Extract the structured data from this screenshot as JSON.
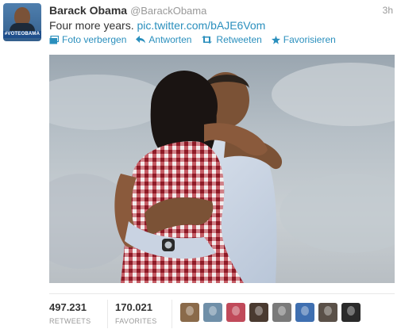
{
  "user": {
    "full_name": "Barack Obama",
    "username": "@BarackObama",
    "avatar_tag": "#VOTEOBAMA",
    "avatar_icon": "profile-photo"
  },
  "tweet": {
    "time": "3h",
    "text": "Four more years.",
    "link": "pic.twitter.com/bAJE6Vom"
  },
  "actions": [
    {
      "label": "Foto verbergen",
      "icon": "photo-icon"
    },
    {
      "label": "Antworten",
      "icon": "reply-icon"
    },
    {
      "label": "Retweeten",
      "icon": "retweet-icon"
    },
    {
      "label": "Favorisieren",
      "icon": "star-icon"
    }
  ],
  "stats": {
    "retweets_count": "497.231",
    "retweets_label": "RETWEETS",
    "favorites_count": "170.021",
    "favorites_label": "FAVORITES"
  },
  "favoriters": [
    {
      "name": "favoriter-avatar-1",
      "color": "#8a6a4a"
    },
    {
      "name": "favoriter-avatar-2",
      "color": "#6f8fa8"
    },
    {
      "name": "favoriter-avatar-3",
      "color": "#c04a5a"
    },
    {
      "name": "favoriter-avatar-4",
      "color": "#4a3a30"
    },
    {
      "name": "favoriter-avatar-5",
      "color": "#7a7a7a"
    },
    {
      "name": "favoriter-avatar-6",
      "color": "#3f6fb0"
    },
    {
      "name": "favoriter-avatar-7",
      "color": "#5a5048"
    },
    {
      "name": "favoriter-avatar-8",
      "color": "#2a2a2a"
    }
  ],
  "colors": {
    "link": "#2a8fbd",
    "name": "#333333",
    "muted": "#999999"
  }
}
